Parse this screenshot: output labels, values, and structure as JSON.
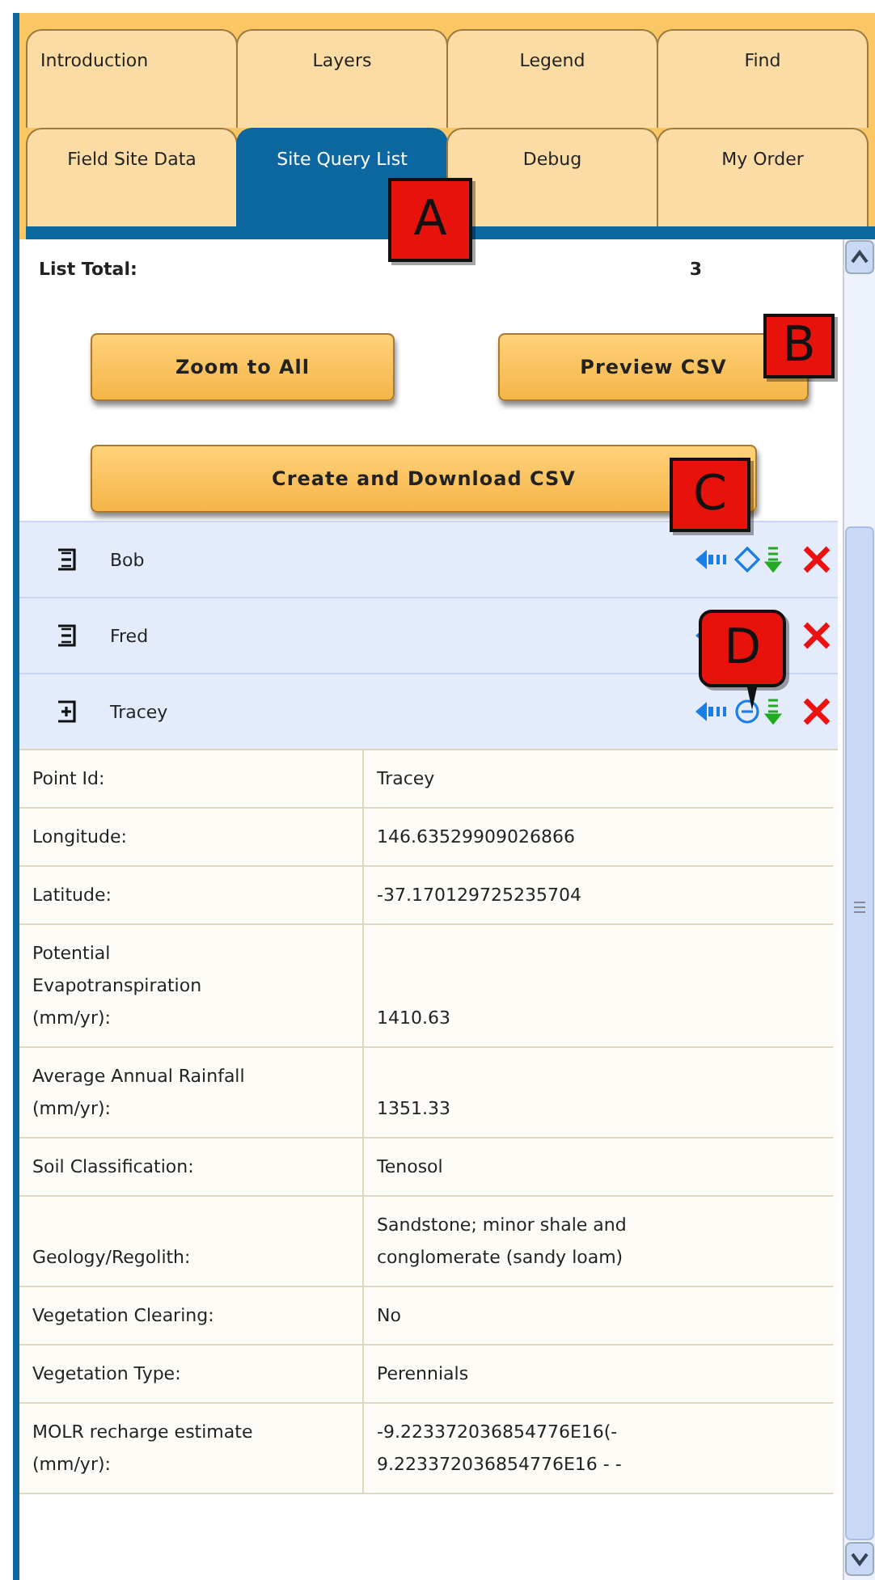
{
  "tab_rows": [
    [
      {
        "label": "Introduction",
        "selected": false
      },
      {
        "label": "Layers",
        "selected": false
      },
      {
        "label": "Legend",
        "selected": false
      },
      {
        "label": "Find",
        "selected": false
      }
    ],
    [
      {
        "label": "Field Site Data",
        "selected": false
      },
      {
        "label": "Site Query List",
        "selected": true
      },
      {
        "label": "Debug",
        "selected": false
      },
      {
        "label": "My Order",
        "selected": false
      }
    ]
  ],
  "list_total": {
    "label": "List Total:",
    "value": "3"
  },
  "buttons": [
    "Zoom to All",
    "Preview CSV",
    "Create and Download CSV"
  ],
  "sites": [
    {
      "name": "Bob",
      "expanded": false
    },
    {
      "name": "Fred",
      "expanded": false
    },
    {
      "name": "Tracey",
      "expanded": true
    }
  ],
  "details": [
    {
      "label": "Point Id:",
      "value": "Tracey"
    },
    {
      "label": "Longitude:",
      "value": "146.63529909026866"
    },
    {
      "label": "Latitude:",
      "value": "-37.170129725235704"
    },
    {
      "label": "Potential Evapotranspiration (mm/yr):",
      "value": "1410.63"
    },
    {
      "label": "Average Annual Rainfall (mm/yr):",
      "value": "1351.33"
    },
    {
      "label": "Soil Classification:",
      "value": "Tenosol"
    },
    {
      "label": "Geology/Regolith:",
      "value": "Sandstone; minor shale and conglomerate (sandy loam)"
    },
    {
      "label": "Vegetation Clearing:",
      "value": "No"
    },
    {
      "label": "Vegetation Type:",
      "value": "Perennials"
    },
    {
      "label": "MOLR recharge estimate (mm/yr):",
      "value_lines": [
        "-9.223372036854776E16(-",
        "9.223372036854776E16 - -"
      ]
    }
  ],
  "callouts": [
    "A",
    "B",
    "C",
    "D"
  ]
}
